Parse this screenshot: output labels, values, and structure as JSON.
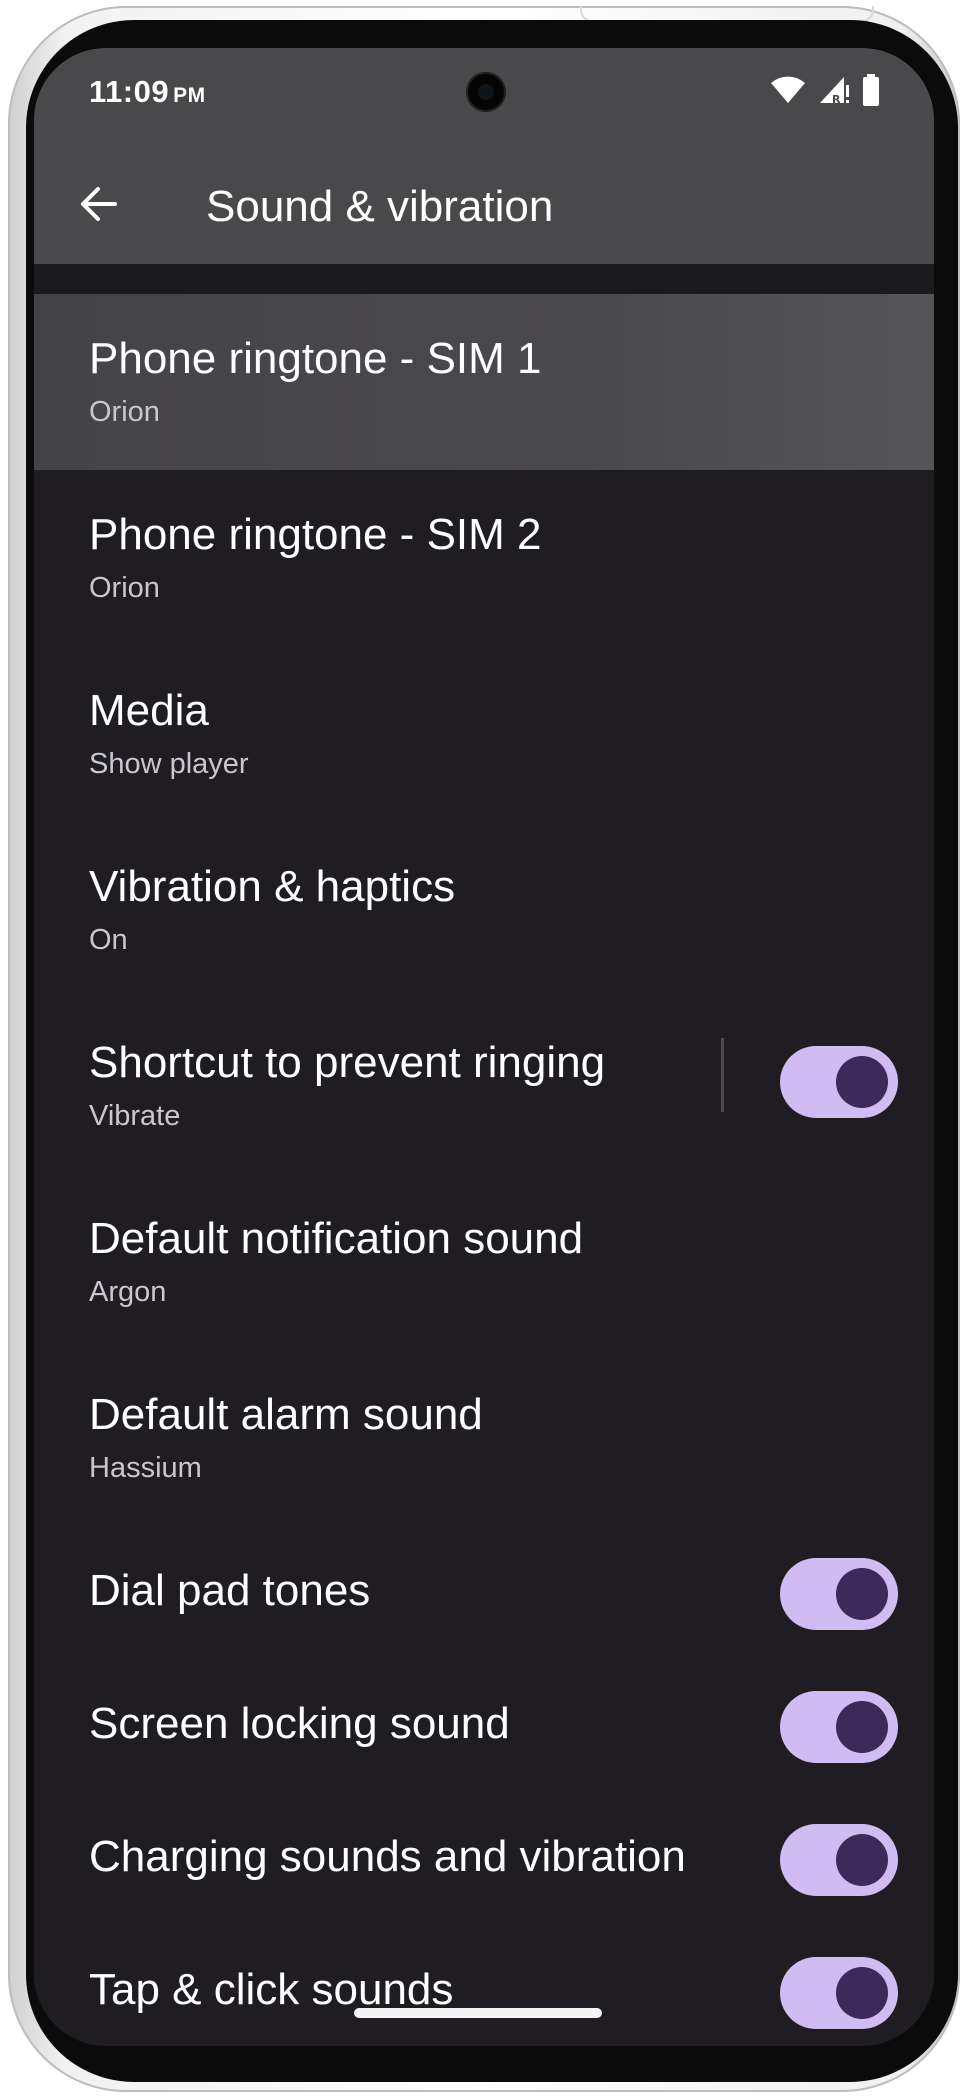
{
  "status_bar": {
    "time": "11:09",
    "ampm": "PM",
    "icons": [
      "wifi-icon",
      "signal-icon",
      "battery-icon"
    ]
  },
  "app_bar": {
    "back_icon": "arrow-back-icon",
    "title": "Sound & vibration"
  },
  "items": [
    {
      "title": "Phone ringtone - SIM 1",
      "subtitle": "Orion"
    },
    {
      "title": "Phone ringtone - SIM 2",
      "subtitle": "Orion"
    },
    {
      "title": "Media",
      "subtitle": "Show player"
    },
    {
      "title": "Vibration & haptics",
      "subtitle": "On"
    },
    {
      "title": "Shortcut to prevent ringing",
      "subtitle": "Vibrate",
      "toggle": true
    },
    {
      "title": "Default notification sound",
      "subtitle": "Argon"
    },
    {
      "title": "Default alarm sound",
      "subtitle": "Hassium"
    },
    {
      "title": "Dial pad tones",
      "toggle": true
    },
    {
      "title": "Screen locking sound",
      "toggle": true
    },
    {
      "title": "Charging sounds and vibration",
      "toggle": true
    },
    {
      "title": "Tap & click sounds",
      "toggle": true
    }
  ],
  "colors": {
    "background": "#1f1d22",
    "app_bar": "#49484b",
    "toggle_track": "#d0bbf2",
    "toggle_knob": "#3b2a5a"
  }
}
